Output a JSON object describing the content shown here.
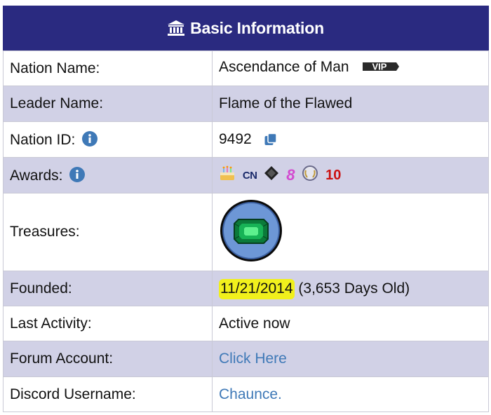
{
  "header": {
    "title": "Basic Information",
    "icon": "bank-icon",
    "background": "#2a2a80"
  },
  "rows": {
    "nation_name": {
      "label": "Nation Name:",
      "value": "Ascendance of Man",
      "badge": "VIP"
    },
    "leader_name": {
      "label": "Leader Name:",
      "value": "Flame of the Flawed"
    },
    "nation_id": {
      "label": "Nation ID:",
      "value": "9492"
    },
    "awards": {
      "label": "Awards:",
      "cn_text": "CN",
      "eight_text": "8",
      "ten_text": "10"
    },
    "treasures": {
      "label": "Treasures:",
      "item": "emerald-gem"
    },
    "founded": {
      "label": "Founded:",
      "date": "11/21/2014",
      "age": "(3,653 Days Old)"
    },
    "last_activity": {
      "label": "Last Activity:",
      "value": "Active now"
    },
    "forum_account": {
      "label": "Forum Account:",
      "value": "Click Here"
    },
    "discord": {
      "label": "Discord Username:",
      "value": "Chaunce."
    }
  },
  "colors": {
    "row_alt": "#d1d1e6",
    "link": "#3f79b7",
    "highlight": "#f1f01c",
    "info_icon": "#3f79b7"
  }
}
